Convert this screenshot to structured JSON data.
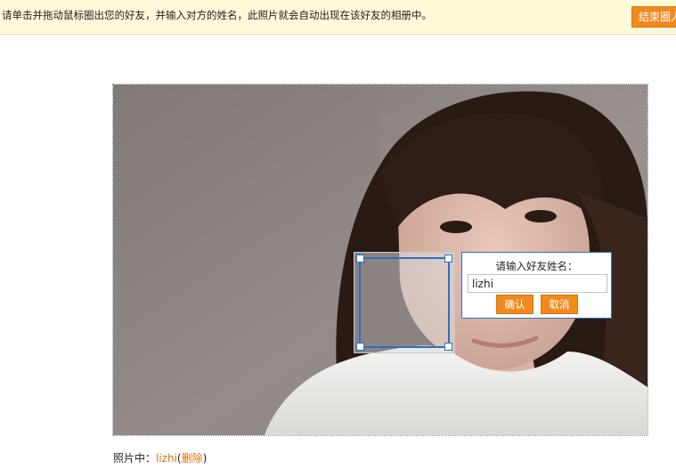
{
  "tip_bar": {
    "text": "请单击并拖动鼠标圈出您的好友，并输入对方的姓名，此照片就会自动出现在该好友的相册中。",
    "end_button_label": "结束圈人"
  },
  "name_popup": {
    "label": "请输入好友姓名：",
    "input_value": "lizhi",
    "confirm_label": "确认",
    "cancel_label": "取消"
  },
  "tagged": {
    "prefix": "照片中：",
    "name": "lizhi",
    "open_paren": "(",
    "delete_label": "删除",
    "close_paren": ")"
  },
  "colors": {
    "accent": "#f08a1e",
    "selection_border": "#2d6fc4",
    "tip_background": "#fff9d9"
  }
}
